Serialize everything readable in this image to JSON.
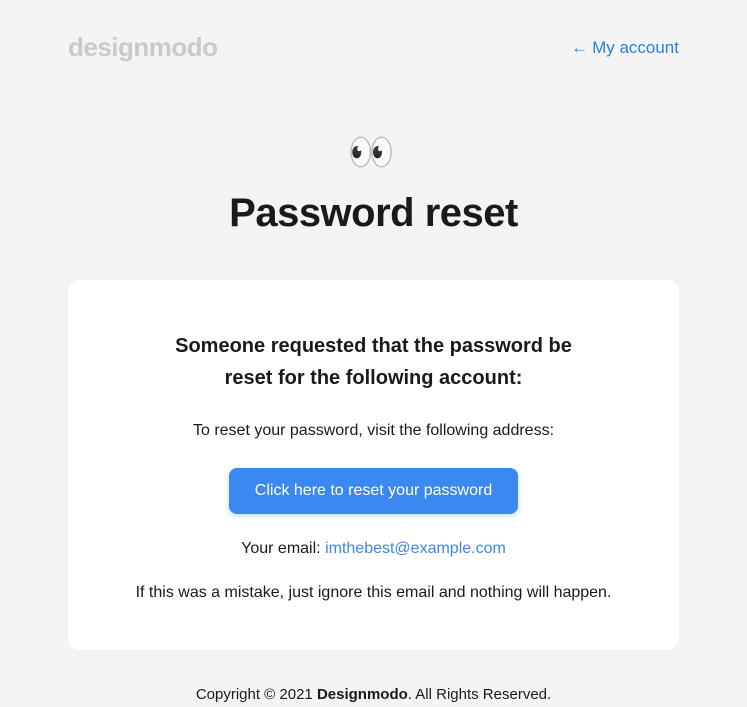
{
  "header": {
    "logo": "designmodo",
    "account_link": "My account",
    "arrow": "←"
  },
  "hero": {
    "eyes": "👀",
    "title": "Password reset"
  },
  "card": {
    "heading_line1": "Someone requested that the password be",
    "heading_line2": "reset for the following account:",
    "instruction": "To reset your password, visit the following address:",
    "button_label": "Click here to reset your password",
    "email_label": "Your email: ",
    "email_value": "imthebest@example.com",
    "disclaimer": "If this was a mistake, just ignore this email and nothing will happen."
  },
  "footer": {
    "prefix": "Copyright © 2021 ",
    "brand": "Designmodo",
    "suffix": ". All Rights Reserved."
  }
}
